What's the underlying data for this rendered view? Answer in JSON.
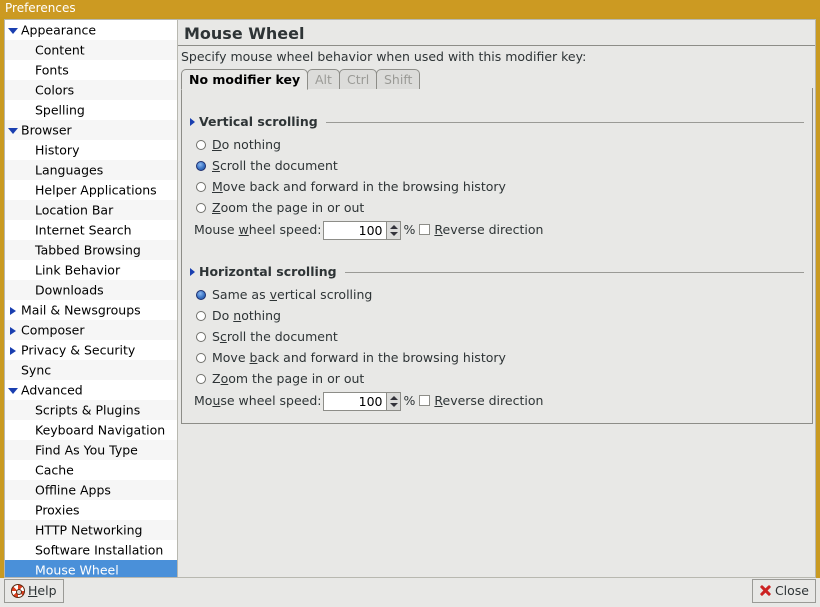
{
  "window": {
    "title": "Preferences",
    "titlebar_color": "#cc9a22"
  },
  "sidebar": {
    "items": [
      {
        "label": "Appearance",
        "level": 1,
        "twisty": "down",
        "selected": false
      },
      {
        "label": "Content",
        "level": 2,
        "twisty": "none",
        "selected": false
      },
      {
        "label": "Fonts",
        "level": 2,
        "twisty": "none",
        "selected": false
      },
      {
        "label": "Colors",
        "level": 2,
        "twisty": "none",
        "selected": false
      },
      {
        "label": "Spelling",
        "level": 2,
        "twisty": "none",
        "selected": false
      },
      {
        "label": "Browser",
        "level": 1,
        "twisty": "down",
        "selected": false
      },
      {
        "label": "History",
        "level": 2,
        "twisty": "none",
        "selected": false
      },
      {
        "label": "Languages",
        "level": 2,
        "twisty": "none",
        "selected": false
      },
      {
        "label": "Helper Applications",
        "level": 2,
        "twisty": "none",
        "selected": false
      },
      {
        "label": "Location Bar",
        "level": 2,
        "twisty": "none",
        "selected": false
      },
      {
        "label": "Internet Search",
        "level": 2,
        "twisty": "none",
        "selected": false
      },
      {
        "label": "Tabbed Browsing",
        "level": 2,
        "twisty": "none",
        "selected": false
      },
      {
        "label": "Link Behavior",
        "level": 2,
        "twisty": "none",
        "selected": false
      },
      {
        "label": "Downloads",
        "level": 2,
        "twisty": "none",
        "selected": false
      },
      {
        "label": "Mail & Newsgroups",
        "level": 1,
        "twisty": "right",
        "selected": false
      },
      {
        "label": "Composer",
        "level": 1,
        "twisty": "right",
        "selected": false
      },
      {
        "label": "Privacy & Security",
        "level": 1,
        "twisty": "right",
        "selected": false
      },
      {
        "label": "Sync",
        "level": 1,
        "twisty": "none",
        "selected": false
      },
      {
        "label": "Advanced",
        "level": 1,
        "twisty": "down",
        "selected": false
      },
      {
        "label": "Scripts & Plugins",
        "level": 2,
        "twisty": "none",
        "selected": false
      },
      {
        "label": "Keyboard Navigation",
        "level": 2,
        "twisty": "none",
        "selected": false
      },
      {
        "label": "Find As You Type",
        "level": 2,
        "twisty": "none",
        "selected": false
      },
      {
        "label": "Cache",
        "level": 2,
        "twisty": "none",
        "selected": false
      },
      {
        "label": "Offline Apps",
        "level": 2,
        "twisty": "none",
        "selected": false
      },
      {
        "label": "Proxies",
        "level": 2,
        "twisty": "none",
        "selected": false
      },
      {
        "label": "HTTP Networking",
        "level": 2,
        "twisty": "none",
        "selected": false
      },
      {
        "label": "Software Installation",
        "level": 2,
        "twisty": "none",
        "selected": false
      },
      {
        "label": "Mouse Wheel",
        "level": 2,
        "twisty": "none",
        "selected": true
      }
    ],
    "selection_color": "#4a90d9"
  },
  "main": {
    "title": "Mouse Wheel",
    "description": "Specify mouse wheel behavior when used with this modifier key:",
    "tabs": [
      {
        "label": "No modifier key",
        "active": true
      },
      {
        "label": "Alt",
        "active": false
      },
      {
        "label": "Ctrl",
        "active": false
      },
      {
        "label": "Shift",
        "active": false
      }
    ],
    "groups": [
      {
        "title": "Vertical scrolling",
        "options": [
          {
            "label": "Do nothing",
            "mnemonic": "D",
            "selected": false
          },
          {
            "label": "Scroll the document",
            "mnemonic": "S",
            "selected": true
          },
          {
            "label": "Move back and forward in the browsing history",
            "mnemonic": "M",
            "selected": false
          },
          {
            "label": "Zoom the page in or out",
            "mnemonic": "Z",
            "selected": false
          }
        ],
        "speed": {
          "label_before": "Mouse ",
          "mnemonic": "w",
          "label_after": "heel speed:",
          "value": "100",
          "unit": "%",
          "reverse_before": "",
          "reverse_mnemonic": "R",
          "reverse_after": "everse direction",
          "reverse_checked": false
        }
      },
      {
        "title": "Horizontal scrolling",
        "options": [
          {
            "label": "Same as vertical scrolling",
            "mnemonic": "v",
            "selected": true
          },
          {
            "label": "Do nothing",
            "mnemonic": "n",
            "selected": false
          },
          {
            "label": "Scroll the document",
            "mnemonic": "c",
            "selected": false
          },
          {
            "label": "Move back and forward in the browsing history",
            "mnemonic": "b",
            "selected": false
          },
          {
            "label": "Zoom the page in or out",
            "mnemonic": "o",
            "selected": false
          }
        ],
        "speed": {
          "label_before": "Mo",
          "mnemonic": "u",
          "label_after": "se wheel speed:",
          "value": "100",
          "unit": "%",
          "reverse_before": "",
          "reverse_mnemonic": "R",
          "reverse_after": "everse direction",
          "reverse_checked": false
        }
      }
    ]
  },
  "bottom": {
    "help_label_before": "H",
    "help_mnemonic": "H",
    "help_label": "Help",
    "close_label": "Close",
    "help_icon": "lifesaver-icon",
    "close_icon": "x-mark-icon"
  }
}
